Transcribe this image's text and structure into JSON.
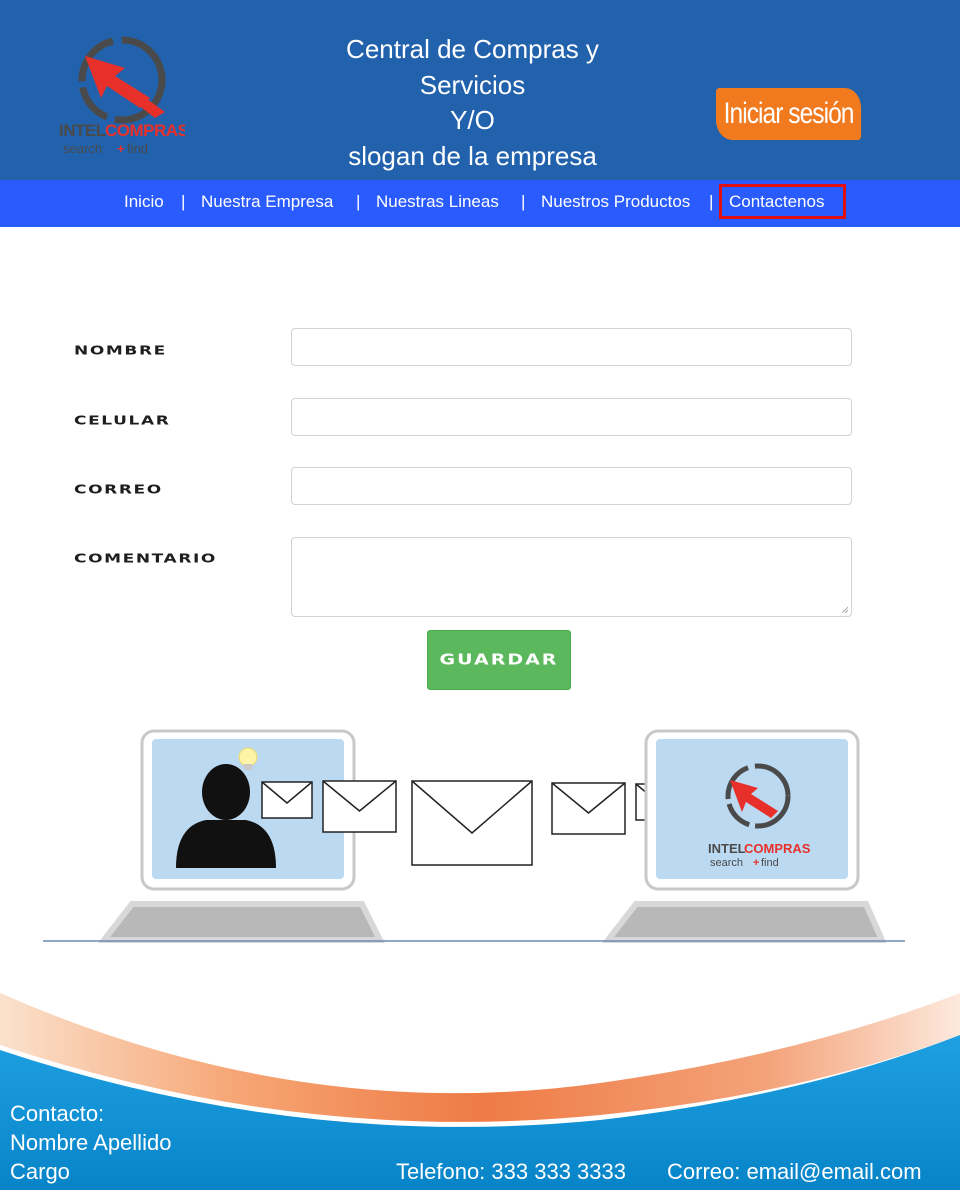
{
  "brand": {
    "logo_name": "INTELCOMPRAS",
    "logo_tagline": "search+find"
  },
  "header": {
    "title_line1": "Central de Compras y",
    "title_line2": "Servicios",
    "title_line3": "Y/O",
    "title_line4": "slogan de la empresa",
    "login_label": "Iniciar sesión"
  },
  "nav": {
    "items": [
      {
        "label": "Inicio"
      },
      {
        "label": "Nuestra Empresa"
      },
      {
        "label": "Nuestras Lineas"
      },
      {
        "label": "Nuestros Productos"
      },
      {
        "label": "Contactenos"
      }
    ],
    "separator": "|",
    "active": "Contactenos"
  },
  "form": {
    "name_label": "NOMBRE",
    "name_value": "",
    "phone_label": "CELULAR",
    "phone_value": "",
    "email_label": "CORREO",
    "email_value": "",
    "comment_label": "COMENTARIO",
    "comment_value": "",
    "save_label": "GUARDAR"
  },
  "footer": {
    "contact_heading": "Contacto:",
    "contact_name": "Nombre Apellido",
    "contact_role": "Cargo",
    "phone": "Telefono: 333 333 3333",
    "email": "Correo: email@email.com"
  },
  "colors": {
    "header_bg": "#2262ad",
    "nav_bg": "#2a5bff",
    "accent_orange": "#f07a1d",
    "active_border": "#e01010",
    "save_green": "#5cb85c",
    "footer_blue": "#0a8fd4"
  }
}
